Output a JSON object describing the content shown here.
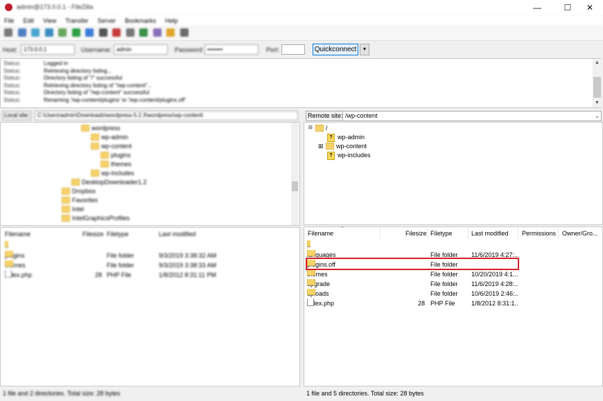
{
  "window": {
    "title": "admin@173.0.0.1 - FileZilla",
    "minimize": "—",
    "maximize": "☐",
    "close": "✕"
  },
  "menu": [
    "File",
    "Edit",
    "View",
    "Transfer",
    "Server",
    "Bookmarks",
    "Help"
  ],
  "toolbar": {
    "icons": [
      "site-manager-icon",
      "toggle-log-icon",
      "toggle-local-tree-icon",
      "toggle-remote-tree-icon",
      "toggle-queue-icon",
      "refresh-icon",
      "process-queue-icon",
      "cancel-icon",
      "disconnect-icon",
      "reconnect-icon",
      "filter-icon",
      "compare-icon",
      "sync-browse-icon",
      "search-icon"
    ],
    "colors": [
      "#7a7a7a",
      "#4f7fc1",
      "#4aa6cf",
      "#3c8cbf",
      "#6aa55d",
      "#2ea043",
      "#3b7dd8",
      "#555555",
      "#c63b3b",
      "#777777",
      "#3a8f4a",
      "#8a6fb8",
      "#e0a52c",
      "#6b6b6b"
    ]
  },
  "quickconnect": {
    "host_label": "Host:",
    "host_value": "173.0.0.1",
    "username_label": "Username:",
    "username_value": "admin",
    "password_label": "Password:",
    "password_value": "••••••••",
    "port_label": "Port:",
    "port_value": "",
    "button": "Quickconnect",
    "dropdown": "▼"
  },
  "log": [
    {
      "type": "Status:",
      "msg": "Logged in"
    },
    {
      "type": "Status:",
      "msg": "Retrieving directory listing..."
    },
    {
      "type": "Status:",
      "msg": "Directory listing of \"/\" successful"
    },
    {
      "type": "Status:",
      "msg": "Retrieving directory listing of \"/wp-content\"..."
    },
    {
      "type": "Status:",
      "msg": "Directory listing of \"/wp-content\" successful"
    },
    {
      "type": "Status:",
      "msg": "Renaming '/wp-content/plugins' to '/wp-content/plugins.off'"
    }
  ],
  "local": {
    "site_label": "Local site:",
    "site_path": "C:\\Users\\admin\\Downloads\\wordpress-5.2.3\\wordpress\\wp-content\\",
    "tree": [
      {
        "label": "wordpress",
        "indent": 4
      },
      {
        "label": "wp-admin",
        "indent": 5
      },
      {
        "label": "wp-content",
        "indent": 5
      },
      {
        "label": "plugins",
        "indent": 6
      },
      {
        "label": "themes",
        "indent": 6
      },
      {
        "label": "wp-includes",
        "indent": 5
      },
      {
        "label": "DesktopDownloader1.2",
        "indent": 3
      },
      {
        "label": "Dropbox",
        "indent": 2
      },
      {
        "label": "Favorites",
        "indent": 2
      },
      {
        "label": "Intel",
        "indent": 2
      },
      {
        "label": "IntelGraphicsProfiles",
        "indent": 2
      }
    ],
    "columns": [
      "Filename",
      "Filesize",
      "Filetype",
      "Last modified"
    ],
    "files": [
      {
        "name": "..",
        "size": "",
        "type": "",
        "modified": "",
        "icon": "folder"
      },
      {
        "name": "plugins",
        "size": "",
        "type": "File folder",
        "modified": "9/3/2019 3:38:32 AM",
        "icon": "folder"
      },
      {
        "name": "themes",
        "size": "",
        "type": "File folder",
        "modified": "9/3/2019 3:38:33 AM",
        "icon": "folder"
      },
      {
        "name": "index.php",
        "size": "28",
        "type": "PHP File",
        "modified": "1/8/2012 8:31:11 PM",
        "icon": "file"
      }
    ],
    "status": "1 file and 2 directories. Total size: 28 bytes"
  },
  "remote": {
    "site_label": "Remote site:",
    "site_path": "/wp-content",
    "tree": [
      {
        "label": "/",
        "kind": "folder",
        "expander": "⊟"
      },
      {
        "label": "wp-admin",
        "kind": "unknown",
        "expander": ""
      },
      {
        "label": "wp-content",
        "kind": "folder",
        "expander": "⊞"
      },
      {
        "label": "wp-includes",
        "kind": "unknown",
        "expander": ""
      }
    ],
    "columns": [
      "Filename",
      "Filesize",
      "Filetype",
      "Last modified",
      "Permissions",
      "Owner/Gro..."
    ],
    "files": [
      {
        "name": "..",
        "size": "",
        "type": "",
        "modified": "",
        "icon": "folder"
      },
      {
        "name": "languages",
        "size": "",
        "type": "File folder",
        "modified": "11/6/2019 4:27:...",
        "icon": "folder"
      },
      {
        "name": "plugins.off",
        "size": "",
        "type": "File folder",
        "modified": "",
        "icon": "folder"
      },
      {
        "name": "themes",
        "size": "",
        "type": "File folder",
        "modified": "10/20/2019 4:1...",
        "icon": "folder"
      },
      {
        "name": "upgrade",
        "size": "",
        "type": "File folder",
        "modified": "11/6/2019 4:28:...",
        "icon": "folder"
      },
      {
        "name": "uploads",
        "size": "",
        "type": "File folder",
        "modified": "10/6/2019 2:46:...",
        "icon": "folder"
      },
      {
        "name": "index.php",
        "size": "28",
        "type": "PHP File",
        "modified": "1/8/2012 8:31:1...",
        "icon": "file"
      }
    ],
    "status": "1 file and 5 directories. Total size: 28 bytes"
  },
  "colors": {
    "highlight": "#d61f26",
    "folder": "#f5d36b",
    "accent": "#0078d7"
  }
}
